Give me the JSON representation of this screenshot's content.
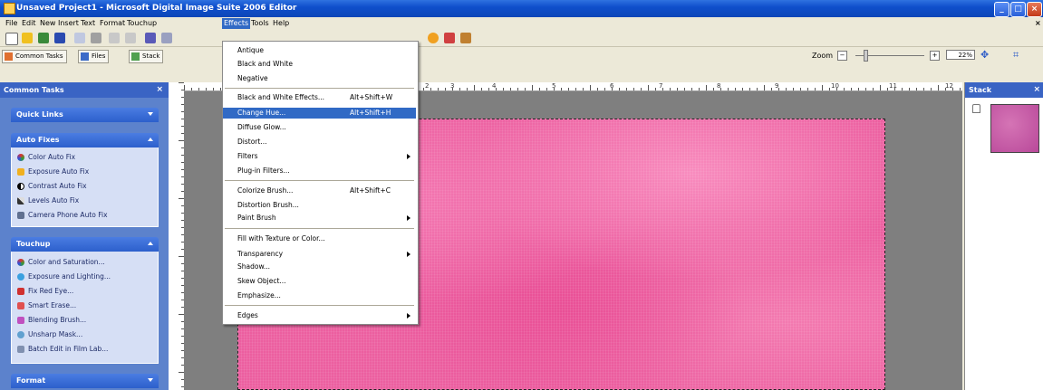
{
  "window": {
    "title": "Unsaved Project1 - Microsoft Digital Image Suite 2006 Editor"
  },
  "menubar": [
    "File",
    "Edit",
    "New",
    "Insert",
    "Text",
    "Format",
    "Touchup",
    "Effects",
    "Tools",
    "Help"
  ],
  "tabs": {
    "common_tasks": "Common Tasks",
    "files": "Files",
    "stack": "Stack"
  },
  "zoom": {
    "label": "Zoom",
    "value": "22%"
  },
  "left_panel": {
    "title": "Common Tasks",
    "quick_links": "Quick Links",
    "auto_fixes": {
      "header": "Auto Fixes",
      "items": [
        "Color Auto Fix",
        "Exposure Auto Fix",
        "Contrast Auto Fix",
        "Levels Auto Fix",
        "Camera Phone Auto Fix"
      ]
    },
    "touchup": {
      "header": "Touchup",
      "items": [
        "Color and Saturation...",
        "Exposure and Lighting...",
        "Fix Red Eye...",
        "Smart Erase...",
        "Blending Brush...",
        "Unsharp Mask...",
        "Batch Edit in Film Lab..."
      ]
    },
    "format": "Format"
  },
  "ruler": {
    "numbers": [
      "2",
      "3",
      "4",
      "5",
      "6",
      "7",
      "8",
      "9",
      "10",
      "11",
      "12"
    ]
  },
  "stack_panel": {
    "title": "Stack"
  },
  "effects_menu": {
    "items": [
      {
        "label": "Antique"
      },
      {
        "label": "Black and White"
      },
      {
        "label": "Negative"
      },
      {
        "label": "Black and White Effects...",
        "shortcut": "Alt+Shift+W"
      },
      {
        "label": "Change Hue...",
        "shortcut": "Alt+Shift+H"
      },
      {
        "label": "Diffuse Glow..."
      },
      {
        "label": "Distort..."
      },
      {
        "label": "Filters"
      },
      {
        "label": "Plug-in Filters..."
      },
      {
        "label": "Colorize Brush...",
        "shortcut": "Alt+Shift+C"
      },
      {
        "label": "Distortion Brush..."
      },
      {
        "label": "Paint Brush"
      },
      {
        "label": "Fill with Texture or Color..."
      },
      {
        "label": "Transparency"
      },
      {
        "label": "Shadow..."
      },
      {
        "label": "Skew Object..."
      },
      {
        "label": "Emphasize..."
      },
      {
        "label": "Edges"
      }
    ]
  },
  "colors": {
    "accent": "#316ac5",
    "title_bar": "#0f4fcc",
    "canvas": "#ec5fa0",
    "panel": "#5c82cc"
  }
}
